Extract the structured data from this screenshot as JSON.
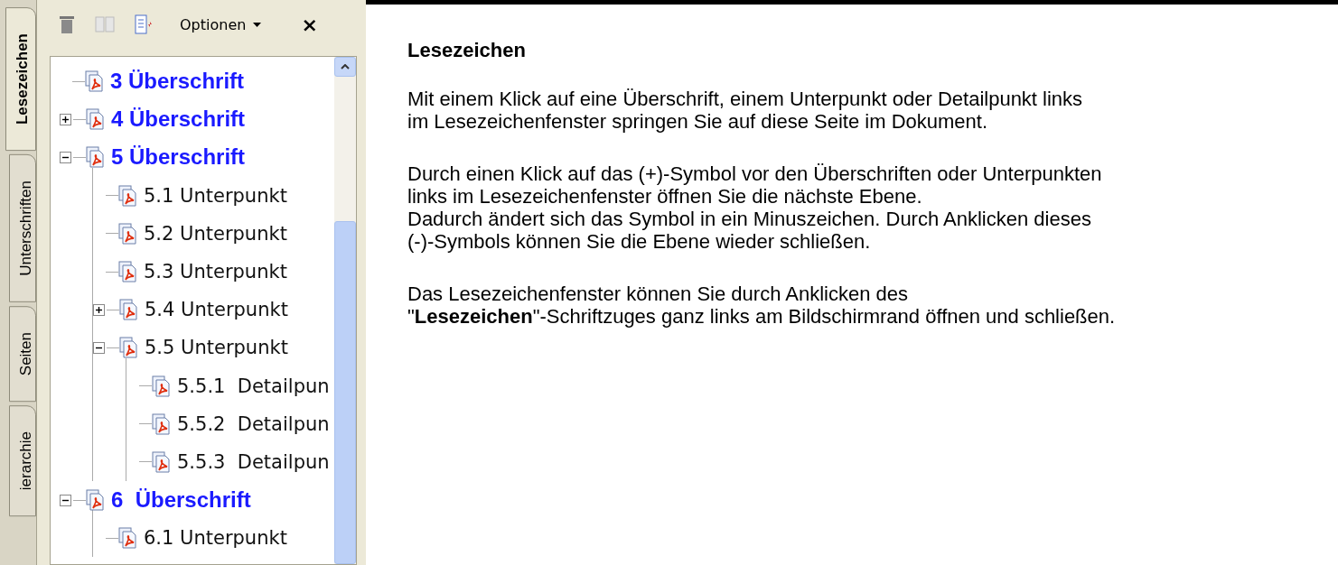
{
  "side_tabs": [
    {
      "label": "Lesezeichen",
      "selected": true
    },
    {
      "label": "Unterschriften",
      "selected": false
    },
    {
      "label": "Seiten",
      "selected": false
    },
    {
      "label": "ierarchie",
      "selected": false
    }
  ],
  "toolbar": {
    "options_label": "Optionen",
    "close_label": "×"
  },
  "bookmarks": [
    {
      "label": "3 Überschrift",
      "kind": "heading"
    },
    {
      "label": "4 Überschrift",
      "kind": "heading",
      "expanded": false
    },
    {
      "label": "5 Überschrift",
      "kind": "heading",
      "expanded": true,
      "children": [
        {
          "label": "5.1 Unterpunkt",
          "kind": "sub"
        },
        {
          "label": "5.2 Unterpunkt",
          "kind": "sub"
        },
        {
          "label": "5.3 Unterpunkt",
          "kind": "sub"
        },
        {
          "label": "5.4 Unterpunkt",
          "kind": "sub",
          "expanded": false
        },
        {
          "label": "5.5 Unterpunkt",
          "kind": "sub",
          "expanded": true,
          "children": [
            {
              "label": "5.5.1  Detailpun",
              "kind": "sub"
            },
            {
              "label": "5.5.2  Detailpun",
              "kind": "sub"
            },
            {
              "label": "5.5.3  Detailpun",
              "kind": "sub"
            }
          ]
        }
      ]
    },
    {
      "label": "6  Überschrift",
      "kind": "heading",
      "expanded": true,
      "children": [
        {
          "label": "6.1 Unterpunkt",
          "kind": "sub"
        }
      ]
    }
  ],
  "document": {
    "title": "Lesezeichen",
    "paragraphs": [
      [
        "Mit einem Klick auf eine Überschrift, einem Unterpunkt oder Detailpunkt links",
        "im Lesezeichenfenster springen Sie auf diese Seite im Dokument."
      ],
      [
        "Durch einen Klick auf das (+)-Symbol vor den Überschriften oder Unterpunkten",
        "links im Lesezeichenfenster öffnen Sie die nächste Ebene.",
        "Dadurch ändert sich das Symbol in ein Minuszeichen. Durch Anklicken dieses",
        "(-)-Symbols können Sie die Ebene wieder schließen."
      ],
      [
        "Das Lesezeichenfenster können Sie durch Anklicken des",
        "\"**Lesezeichen**\"-Schriftzuges ganz links am Bildschirmrand öffnen und schließen."
      ]
    ]
  }
}
